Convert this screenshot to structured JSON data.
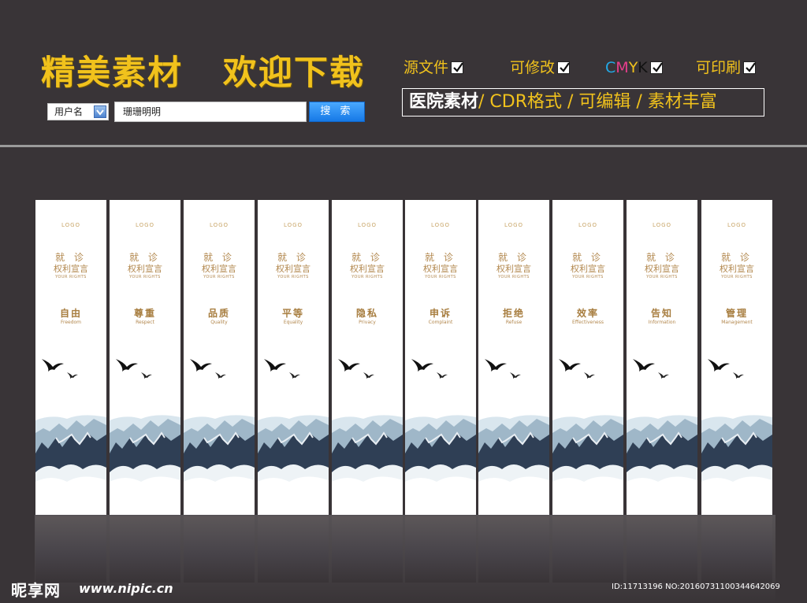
{
  "header": {
    "headline": "精美素材   欢迎下载",
    "search": {
      "select_label": "用户名",
      "input_value": "珊珊明明",
      "button_label": "搜 索"
    },
    "features": [
      {
        "label": "源文件"
      },
      {
        "label": "可修改"
      },
      {
        "label": "可印刷"
      }
    ],
    "cmyk": {
      "c": "C",
      "m": "M",
      "y": "Y",
      "k": "K"
    },
    "tagline": {
      "lead": "医院素材",
      "rest": "/ CDR格式 / 可编辑 / 素材丰富"
    }
  },
  "panel_common": {
    "logo": "LOGO",
    "heading": "就 诊",
    "subheading": "权利宣言",
    "subheading_en": "YOUR RIGHTS"
  },
  "panels": [
    {
      "cn": "自由",
      "en": "Freedom"
    },
    {
      "cn": "尊重",
      "en": "Respect"
    },
    {
      "cn": "品质",
      "en": "Quality"
    },
    {
      "cn": "平等",
      "en": "Equality"
    },
    {
      "cn": "隐私",
      "en": "Privacy"
    },
    {
      "cn": "申诉",
      "en": "Complaint"
    },
    {
      "cn": "拒绝",
      "en": "Refuse"
    },
    {
      "cn": "效率",
      "en": "Effectiveness"
    },
    {
      "cn": "告知",
      "en": "Information"
    },
    {
      "cn": "管理",
      "en": "Management"
    }
  ],
  "watermark": {
    "logo": "昵享网",
    "site": "www.nipic.cn",
    "id": "ID:11713196 NO:20160731100344642069"
  },
  "colors": {
    "background": "#393437",
    "accent_gold": "#f1c21c",
    "panel_text": "#b2874d",
    "button_blue": "#1679e6"
  }
}
